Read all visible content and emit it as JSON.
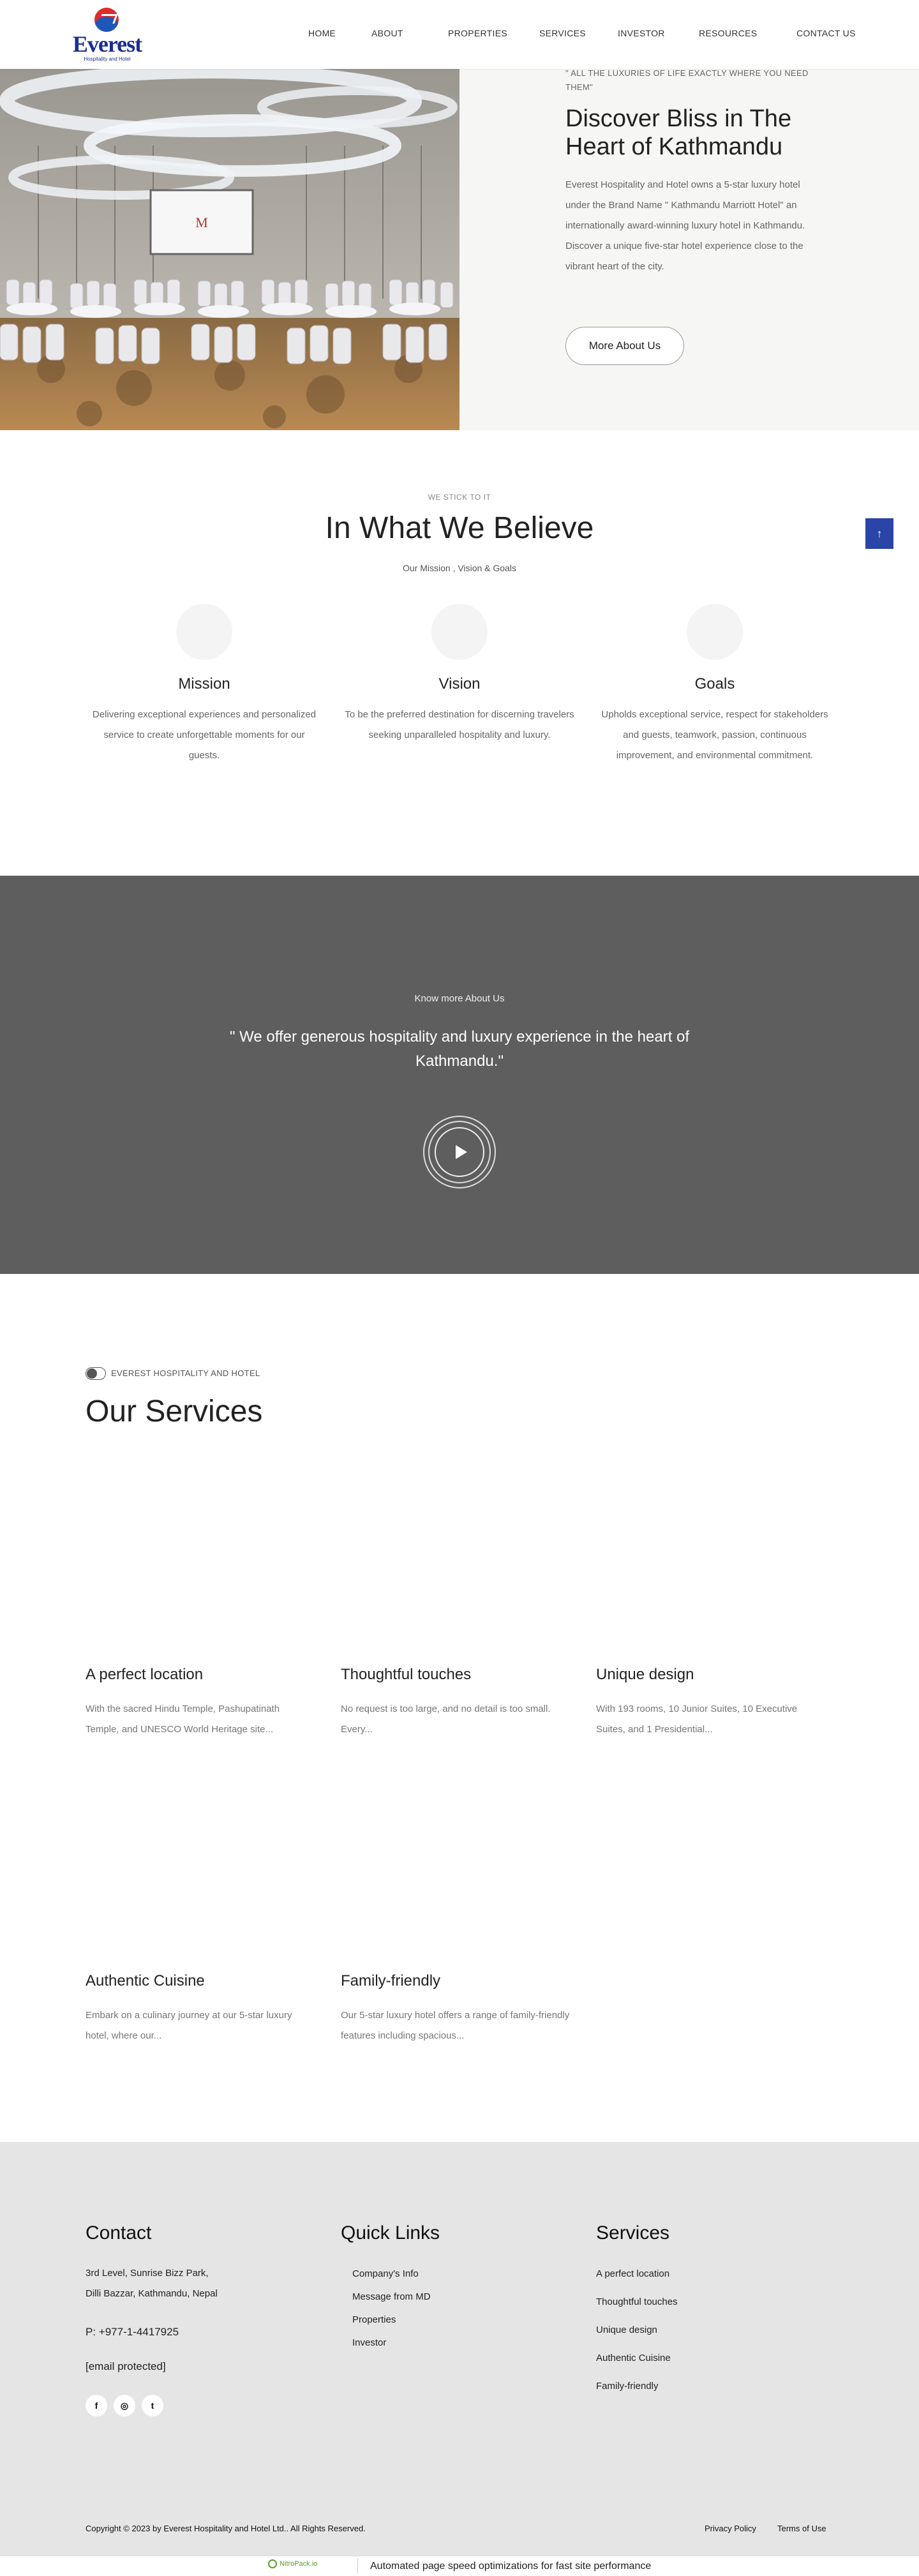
{
  "brand": {
    "name": "Everest",
    "tagline": "Hospitality and Hotel"
  },
  "nav": {
    "items": [
      "HOME",
      "ABOUT",
      "PROPERTIES",
      "SERVICES",
      "INVESTOR",
      "RESOURCES",
      "CONTACT US"
    ]
  },
  "hero": {
    "tag": "\" ALL THE LUXURIES OF LIFE EXACTLY WHERE YOU NEED THEM\"",
    "title": "Discover Bliss in The Heart of Kathmandu",
    "text": "Everest Hospitality and Hotel owns a 5-star luxury hotel under the Brand Name \" Kathmandu Marriott Hotel\" an internationally award-winning luxury hotel in Kathmandu. Discover a unique five-star hotel experience close to the vibrant heart of the city.",
    "button": "More About Us",
    "screen_logo": "M"
  },
  "believe": {
    "tag": "WE STICK TO IT",
    "title": "In What We Believe",
    "subtitle": "Our Mission , Vision & Goals",
    "pillars": [
      {
        "title": "Mission",
        "text": "Delivering exceptional experiences and personalized service to create unforgettable moments for our guests."
      },
      {
        "title": "Vision",
        "text": "To be the preferred destination for discerning travelers seeking unparalleled hospitality and luxury."
      },
      {
        "title": "Goals",
        "text": "Upholds exceptional service, respect for stakeholders and guests, teamwork, passion, continuous improvement, and environmental commitment."
      }
    ],
    "to_top": "↑"
  },
  "about_band": {
    "tag": "Know more About Us",
    "quote": "\" We offer generous hospitality and luxury experience in the heart of Kathmandu.\""
  },
  "services": {
    "tag": "EVEREST HOSPITALITY AND HOTEL",
    "title": "Our Services",
    "cards": [
      {
        "title": "A perfect location",
        "text": "With the sacred Hindu Temple, Pashupatinath Temple, and UNESCO World Heritage site..."
      },
      {
        "title": "Thoughtful touches",
        "text": "No request is too large, and no detail is too small. Every..."
      },
      {
        "title": "Unique design",
        "text": "With 193 rooms, 10 Junior Suites, 10 Executive Suites, and 1 Presidential..."
      },
      {
        "title": "Authentic Cuisine",
        "text": "Embark on a culinary journey at our 5-star luxury hotel, where our..."
      },
      {
        "title": "Family-friendly",
        "text": "Our 5-star luxury hotel offers a range of family-friendly features including spacious..."
      }
    ]
  },
  "footer": {
    "contact": {
      "heading": "Contact",
      "address_line1": "3rd Level, Sunrise Bizz Park,",
      "address_line2": "Dilli Bazzar, Kathmandu, Nepal",
      "phone": "P: +977-1-4417925",
      "email": "[email protected]"
    },
    "social": [
      "f",
      "◎",
      "t"
    ],
    "quick_links": {
      "heading": "Quick Links",
      "items": [
        "Company's Info",
        "Message from MD",
        "Properties",
        "Investor"
      ]
    },
    "services": {
      "heading": "Services",
      "items": [
        "A perfect location",
        "Thoughtful touches",
        "Unique design",
        "Authentic Cuisine",
        "Family-friendly"
      ]
    },
    "copyright": "Copyright © 2023 by Everest Hospitality and Hotel Ltd.. All Rights Reserved.",
    "privacy": "Privacy Policy",
    "terms": "Terms of Use"
  },
  "nitro": {
    "badge": "NitroPack.io",
    "text": "Automated page speed optimizations for fast site performance"
  }
}
